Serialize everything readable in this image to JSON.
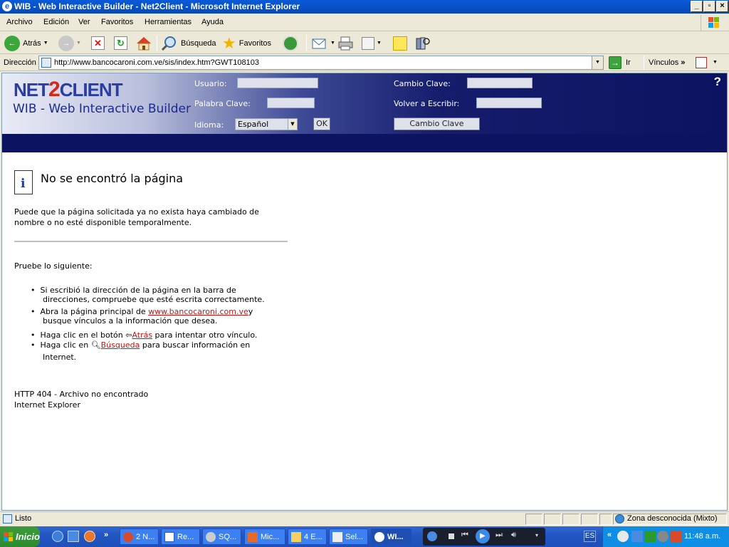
{
  "window": {
    "title": "WIB - Web Interactive Builder - Net2Client - Microsoft Internet Explorer"
  },
  "menu": {
    "items": [
      "Archivo",
      "Edición",
      "Ver",
      "Favoritos",
      "Herramientas",
      "Ayuda"
    ]
  },
  "toolbar": {
    "back_label": "Atrás",
    "search_label": "Búsqueda",
    "favorites_label": "Favoritos"
  },
  "address": {
    "label": "Dirección",
    "url": "http://www.bancocaroni.com.ve/sis/index.htm?GWT108103",
    "go_label": "Ir",
    "links_label": "Vínculos"
  },
  "banner": {
    "logo_text_net": "NET",
    "logo_text_two": "2",
    "logo_text_client": "CLIENT",
    "subtitle": "WIB - Web Interactive Builder",
    "usuario_label": "Usuario:",
    "palabra_label": "Palabra Clave:",
    "idioma_label": "Idioma:",
    "idioma_value": "Español",
    "ok_label": "OK",
    "cambio_label": "Cambio Clave:",
    "volver_label": "Volver a Escribir:",
    "cambio_button": "Cambio Clave",
    "help": "?"
  },
  "error": {
    "title": "No se encontró la página",
    "desc_line1": "Puede que la página solicitada ya no exista haya cambiado de",
    "desc_line2": "nombre o no esté disponible temporalmente.",
    "try_label": "Pruebe lo siguiente:",
    "b1_line1": "Si escribió la dirección de la página en la barra de",
    "b1_line2": "direcciones, compruebe que esté escrita correctamente.",
    "b2_pre": "Abra la página principal de ",
    "b2_link": "www.bancocaroni.com.ve",
    "b2_post": "y",
    "b2_line2": "busque vínculos a la información que desea.",
    "b3_pre": "Haga clic en el botón ",
    "b3_link": "Atrás",
    "b3_post": " para intentar otro vínculo.",
    "b4_pre": "Haga clic en ",
    "b4_link": "Búsqueda",
    "b4_post": " para buscar información en",
    "b4_line2": "Internet.",
    "code": "HTTP 404 - Archivo no encontrado",
    "footer": "Internet Explorer"
  },
  "status": {
    "text": "Listo",
    "zone": "Zona desconocida (Mixto)"
  },
  "taskbar": {
    "start": "Inicio",
    "tasks": [
      "2 N...",
      "Re...",
      "SQ...",
      "Mic...",
      "4 E...",
      "Sel...",
      "WI..."
    ],
    "lang": "ES",
    "clock": "11:48 a.m."
  },
  "colors": {
    "titlebar": "#0a5ad8",
    "banner_dark": "#0c1462",
    "link": "#c41414",
    "taskbar": "#2456c2",
    "start": "#3c9a3c"
  }
}
